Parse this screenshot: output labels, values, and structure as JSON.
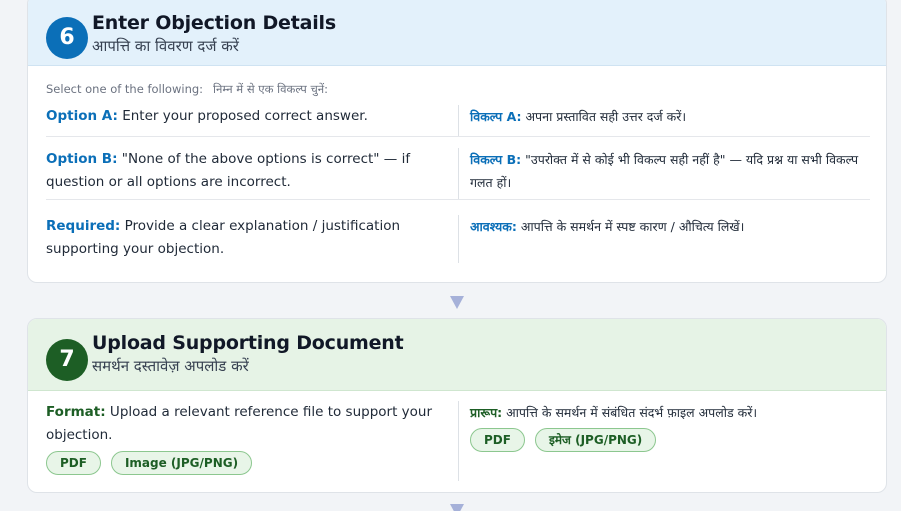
{
  "step6": {
    "number": "6",
    "title": "Enter Objection Details",
    "subtitle": "आपत्ति का विवरण दर्ज करें",
    "instruction_en": "Select one of the following:",
    "instruction_hi": "निम्न में से एक विकल्प चुनें:",
    "rows": [
      {
        "en_key": "Option A:",
        "en_text": " Enter your proposed correct answer.",
        "hi_key": "विकल्प A:",
        "hi_text": " अपना प्रस्तावित सही उत्तर दर्ज करें।"
      },
      {
        "en_key": "Option B:",
        "en_text": " \"None of the above options is correct\" — if question or all options are incorrect.",
        "hi_key": "विकल्प B:",
        "hi_text": " \"उपरोक्त में से कोई भी विकल्प सही नहीं है\" — यदि प्रश्न या सभी विकल्प गलत हों।"
      },
      {
        "en_key": "Required:",
        "en_text": " Provide a clear explanation / justification supporting your objection.",
        "hi_key": "आवश्यक:",
        "hi_text": " आपत्ति के समर्थन में स्पष्ट कारण / औचित्य लिखें।"
      }
    ]
  },
  "step7": {
    "number": "7",
    "title": "Upload Supporting Document",
    "subtitle": "समर्थन दस्तावेज़ अपलोड करें",
    "en_key": "Format:",
    "en_text": " Upload a relevant reference file to support your objection.",
    "hi_key": "प्रारूप:",
    "hi_text": " आपत्ति के समर्थन में संबंधित संदर्भ फ़ाइल अपलोड करें।",
    "pills_en": [
      "PDF",
      "Image (JPG/PNG)"
    ],
    "pills_hi": [
      "PDF",
      "इमेज (JPG/PNG)"
    ]
  },
  "colors": {
    "step6_accent": "#0b6fb8",
    "step7_accent": "#1d5e25",
    "arrow": "#a6b1d9"
  }
}
